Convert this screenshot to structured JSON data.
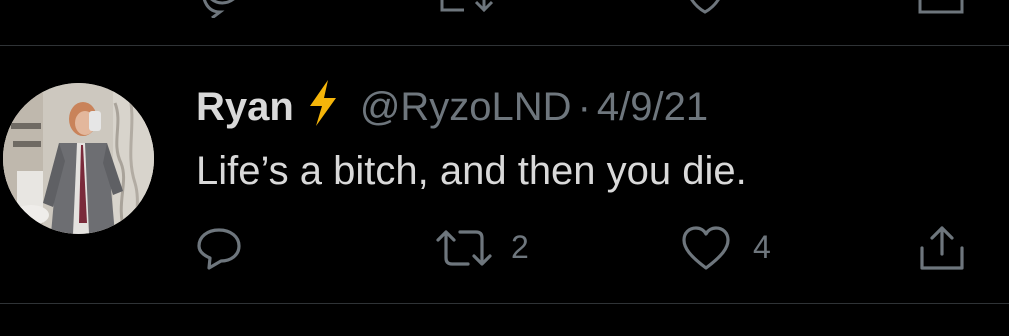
{
  "tweet": {
    "display_name": "Ryan",
    "name_emoji": "lightning-bolt-icon",
    "handle": "@RyzoLND",
    "separator": "·",
    "date": "4/9/21",
    "text": "Life’s a bitch, and then you die.",
    "actions": {
      "reply_icon": "reply-icon",
      "retweet_icon": "retweet-icon",
      "retweet_count": "2",
      "like_icon": "heart-icon",
      "like_count": "4",
      "share_icon": "share-icon"
    }
  },
  "colors": {
    "background": "#000000",
    "primary_text": "#d9d9d9",
    "secondary_text": "#6e767d",
    "divider": "#2f3336",
    "bolt": "#f5b50a"
  }
}
